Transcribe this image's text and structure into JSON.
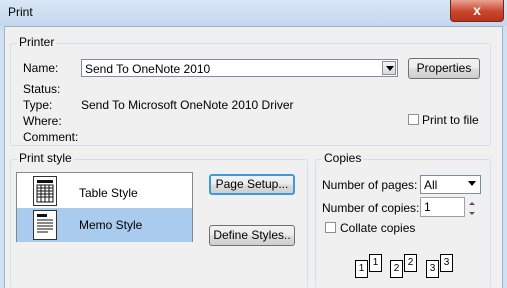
{
  "window": {
    "title": "Print",
    "close_glyph": "x"
  },
  "printer": {
    "group_label": "Printer",
    "name_label": "Name:",
    "name_value": "Send To OneNote 2010",
    "properties_button": "Properties",
    "status_label": "Status:",
    "status_value": "",
    "type_label": "Type:",
    "type_value": "Send To Microsoft OneNote 2010 Driver",
    "where_label": "Where:",
    "where_value": "",
    "comment_label": "Comment:",
    "comment_value": "",
    "print_to_file_label": "Print to file",
    "print_to_file_checked": false
  },
  "print_style": {
    "group_label": "Print style",
    "items": [
      {
        "label": "Table Style",
        "selected": false,
        "icon": "table-style-icon"
      },
      {
        "label": "Memo Style",
        "selected": true,
        "icon": "memo-style-icon"
      }
    ],
    "page_setup_button": "Page Setup...",
    "define_styles_button": "Define Styles.."
  },
  "copies": {
    "group_label": "Copies",
    "num_pages_label": "Number of pages:",
    "num_pages_value": "All",
    "num_copies_label": "Number of copies:",
    "num_copies_value": "1",
    "collate_label": "Collate copies",
    "collate_checked": false,
    "collate_pages": [
      "1",
      "1",
      "2",
      "2",
      "3",
      "3"
    ]
  },
  "colors": {
    "selection": "#a9cbee",
    "focus_border": "#3c9ad9",
    "close_red": "#c9462c"
  }
}
